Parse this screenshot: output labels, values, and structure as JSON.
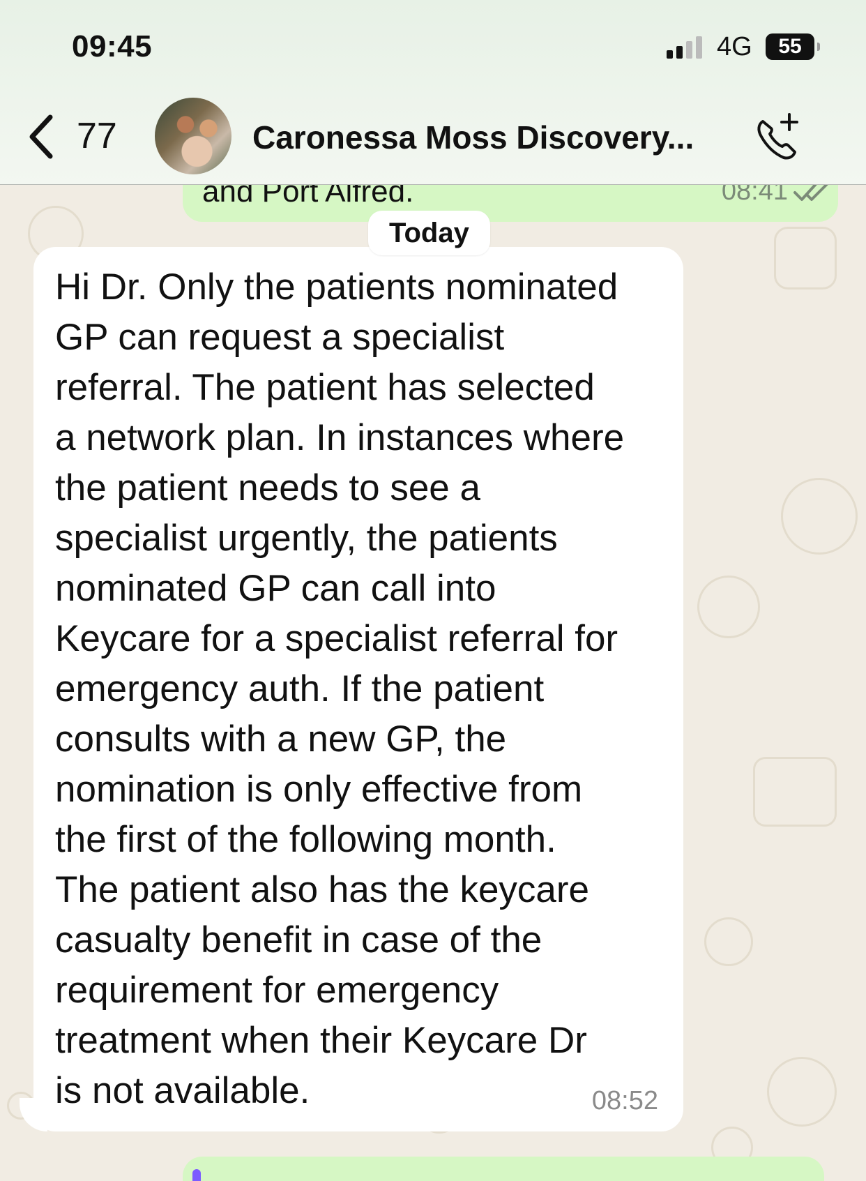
{
  "status_bar": {
    "time": "09:45",
    "network": "4G",
    "battery": "55"
  },
  "header": {
    "back_count": "77",
    "contact_name": "Caronessa Moss Discovery..."
  },
  "messages": {
    "outgoing_partial": {
      "text": "and Port Alfred.",
      "time": "08:41"
    },
    "day_separator": "Today",
    "incoming": {
      "lines": [
        "Hi Dr. Only the patients nominated",
        "GP can request a specialist",
        "referral. The patient has selected",
        "a network plan. In instances where",
        "the patient needs to see a",
        "specialist urgently, the patients",
        "nominated GP can call into",
        "Keycare for a specialist referral for",
        "emergency auth. If the patient",
        "consults with a new GP, the",
        "nomination is only effective from",
        "the first of the following month.",
        "The patient also has  the keycare",
        "casualty benefit in case of the",
        "requirement for emergency",
        "treatment when their Keycare Dr",
        "is not available."
      ],
      "time": "08:52"
    }
  },
  "colors": {
    "outgoing_bubble": "#d6f7c4",
    "incoming_bubble": "#ffffff",
    "wallpaper": "#f1ece3"
  }
}
